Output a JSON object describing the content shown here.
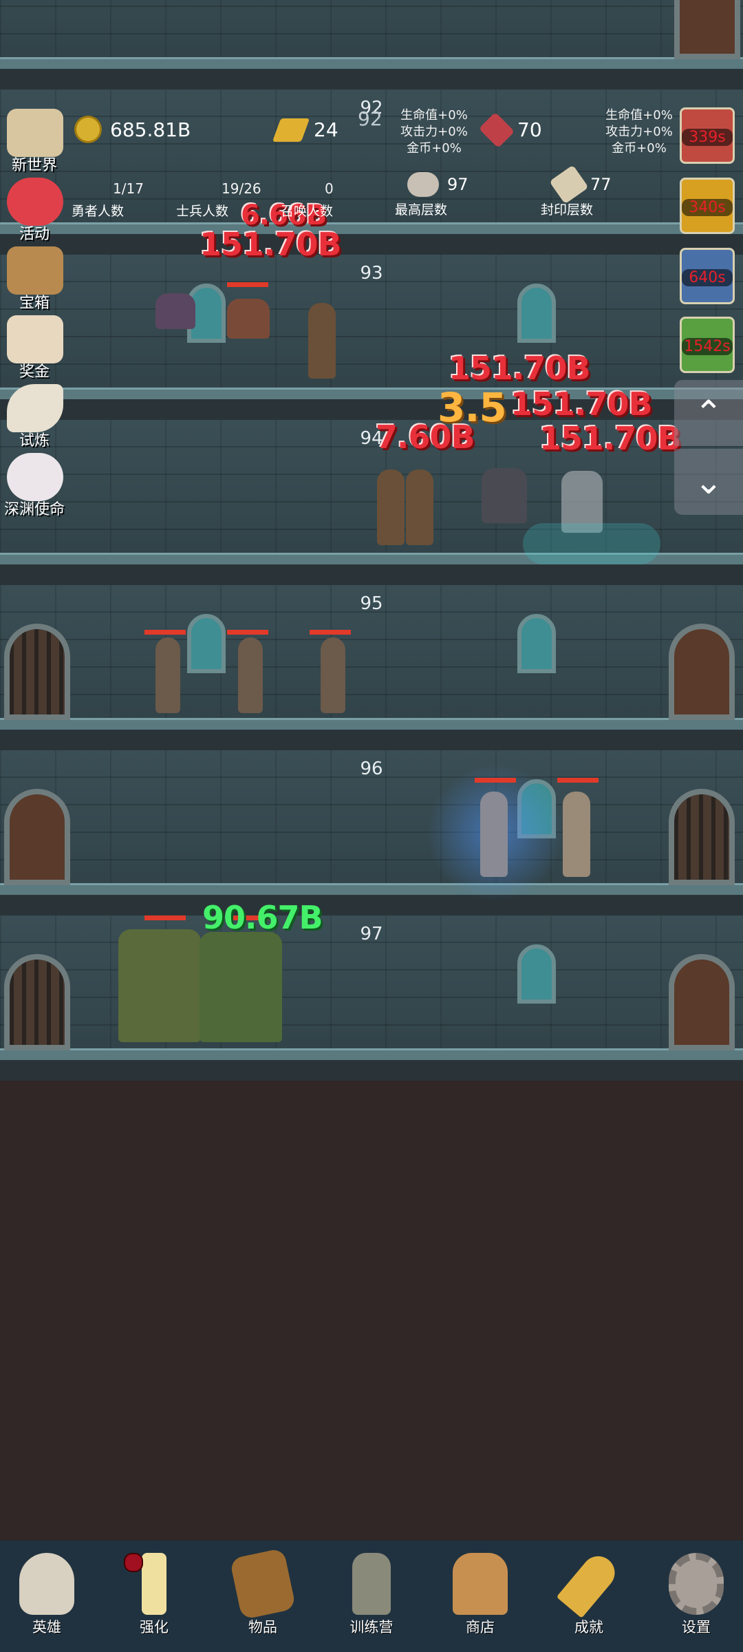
{
  "hud": {
    "gold": "685.81B",
    "gold_bars": "24",
    "current_floor": "92",
    "left_bonus": [
      "生命值+0%",
      "攻击力+0%",
      "金币+0%"
    ],
    "gems": "70",
    "right_bonus": [
      "生命值+0%",
      "攻击力+0%",
      "金币+0%"
    ],
    "heroes_count": "1/17",
    "heroes_label": "勇者人数",
    "soldiers_count": "19/26",
    "soldiers_label": "士兵人数",
    "summons_count": "0",
    "summons_label": "召唤人数",
    "max_floor": "97",
    "max_floor_label": "最高层数",
    "sealed_floor": "77",
    "sealed_floor_label": "封印层数"
  },
  "left_menu": [
    {
      "label": "新世界",
      "icon": "map-scroll-icon",
      "color": "#d8c6a0"
    },
    {
      "label": "活动",
      "icon": "heart-icon",
      "color": "#e0404a"
    },
    {
      "label": "宝箱",
      "icon": "treasure-chest-icon",
      "color": "#b88a50"
    },
    {
      "label": "奖金",
      "icon": "envelope-icon",
      "color": "#e8d8c0"
    },
    {
      "label": "试炼",
      "icon": "feather-icon",
      "color": "#e8e0d0"
    },
    {
      "label": "深渊使命",
      "icon": "pearl-icon",
      "color": "#ece6ea"
    }
  ],
  "timers": [
    {
      "label": "339s",
      "icon": "orb-red-icon",
      "color": "#c04a40"
    },
    {
      "label": "340s",
      "icon": "lamp-gold-icon",
      "color": "#d8a020"
    },
    {
      "label": "640s",
      "icon": "crystal-blue-icon",
      "color": "#4a70a8"
    },
    {
      "label": "1542s",
      "icon": "clover-green-icon",
      "color": "#58a040"
    }
  ],
  "floors": [
    {
      "number": "92"
    },
    {
      "number": "93"
    },
    {
      "number": "94"
    },
    {
      "number": "95"
    },
    {
      "number": "96"
    },
    {
      "number": "97"
    }
  ],
  "damage_numbers": {
    "d1": "151.70B",
    "d2": "151.70B",
    "d3": "3.5",
    "d4": "151.70B",
    "d5": "7.60B",
    "d6": "151.70B",
    "d7": "90.67B",
    "d8": "6.66B"
  },
  "bottom_nav": [
    {
      "label": "英雄",
      "icon": "skull-icon",
      "color": "#d8d0c0"
    },
    {
      "label": "强化",
      "icon": "candle-icon",
      "color": "#f0e0a0"
    },
    {
      "label": "物品",
      "icon": "book-icon",
      "color": "#9a6a30"
    },
    {
      "label": "训练营",
      "icon": "lantern-icon",
      "color": "#8a8a7a"
    },
    {
      "label": "商店",
      "icon": "beer-mug-icon",
      "color": "#c89050"
    },
    {
      "label": "成就",
      "icon": "key-icon",
      "color": "#e0b040"
    },
    {
      "label": "设置",
      "icon": "gear-icon",
      "color": "#a8a098"
    }
  ]
}
